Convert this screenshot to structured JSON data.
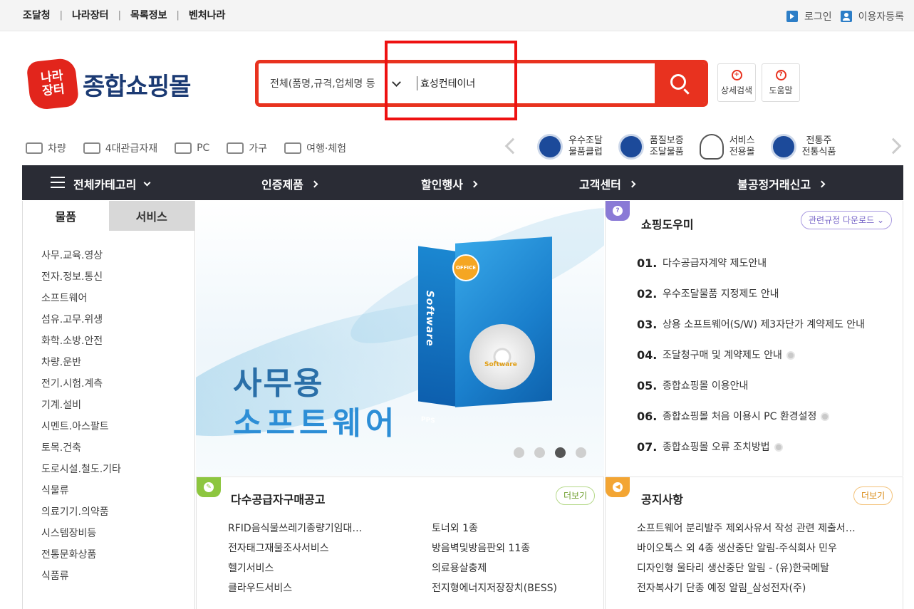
{
  "topbar": {
    "nav": [
      "조달청",
      "나라장터",
      "목록정보",
      "벤처나라"
    ],
    "login": "로그인",
    "register": "이용자등록"
  },
  "logo": {
    "seal_line1": "나라",
    "seal_line2": "장터",
    "text": "종합쇼핑몰"
  },
  "search": {
    "category": "전체(품명,규격,업체명 등",
    "value": "효성컨테이너"
  },
  "header_buttons": {
    "detail_search": "상세검색",
    "help": "도움말"
  },
  "quick_categories": [
    "차량",
    "4대관급자재",
    "PC",
    "가구",
    "여행·체험"
  ],
  "badges": [
    {
      "line1": "우수조달",
      "line2": "물품클럽"
    },
    {
      "line1": "품질보증",
      "line2": "조달물품"
    },
    {
      "line1": "서비스",
      "line2": "전용몰"
    },
    {
      "line1": "전통주",
      "line2": "전통식품"
    }
  ],
  "main_nav": {
    "all_categories": "전체카테고리",
    "items": [
      "인증제품",
      "할인행사",
      "고객센터",
      "불공정거래신고"
    ]
  },
  "sidebar": {
    "tabs": [
      "물품",
      "서비스"
    ],
    "items": [
      "사무.교육.영상",
      "전자.정보.통신",
      "소프트웨어",
      "섬유.고무.위생",
      "화학.소방.안전",
      "차량.운반",
      "전기.시험.계측",
      "기계.설비",
      "시멘트.아스팔트",
      "토목.건축",
      "도로시설.철도.기타",
      "식물류",
      "의료기기.의약품",
      "시스템장비등",
      "전통문화상품",
      "식품류"
    ]
  },
  "banner": {
    "line1": "사무용",
    "line2": "소프트웨어",
    "box_label": "Software",
    "disc_label": "Software",
    "seal_label": "OFFICE",
    "maker": "PPS",
    "slide_count": 4,
    "active_slide": 3
  },
  "help_panel": {
    "title": "쇼핑도우미",
    "download": "관련규정 다운로드",
    "items": [
      {
        "num": "01.",
        "text": "다수공급자계약 제도안내",
        "clip": false
      },
      {
        "num": "02.",
        "text": "우수조달물품 지정제도 안내",
        "clip": false
      },
      {
        "num": "03.",
        "text": "상용 소프트웨어(S/W) 제3자단가 계약제도 안내",
        "clip": false
      },
      {
        "num": "04.",
        "text": "조달청구매 및 계약제도 안내",
        "clip": true
      },
      {
        "num": "05.",
        "text": "종합쇼핑몰 이용안내",
        "clip": false
      },
      {
        "num": "06.",
        "text": "종합쇼핑몰 처음 이용시 PC 환경설정",
        "clip": true
      },
      {
        "num": "07.",
        "text": "종합쇼핑몰 오류 조치방법",
        "clip": true
      }
    ]
  },
  "mas_panel": {
    "title": "다수공급자구매공고",
    "more": "더보기",
    "col1": [
      "RFID음식물쓰레기종량기임대…",
      "전자태그재물조사서비스",
      "헬기서비스",
      "클라우드서비스"
    ],
    "col2": [
      "토너외 1종",
      "방음벽및방음판외 11종",
      "의료용살충제",
      "전지형에너지저장장치(BESS)"
    ]
  },
  "notice_panel": {
    "title": "공지사항",
    "more": "더보기",
    "items": [
      "소프트웨어 분리발주 제외사유서 작성 관련 제출서…",
      "바이오톡스 외 4종 생산중단 알림-주식회사 민우",
      "디자인형 울타리 생산중단 알림 - (유)한국메탈",
      "전자복사기 단종 예정 알림_삼성전자(주)"
    ]
  },
  "colors": {
    "accent_red": "#e8321f",
    "nav_dark": "#2a2c35",
    "brand_navy": "#1b3a73",
    "help_purple": "#8a7ad6",
    "mas_green": "#8dc63f",
    "notice_orange": "#f3a533"
  }
}
